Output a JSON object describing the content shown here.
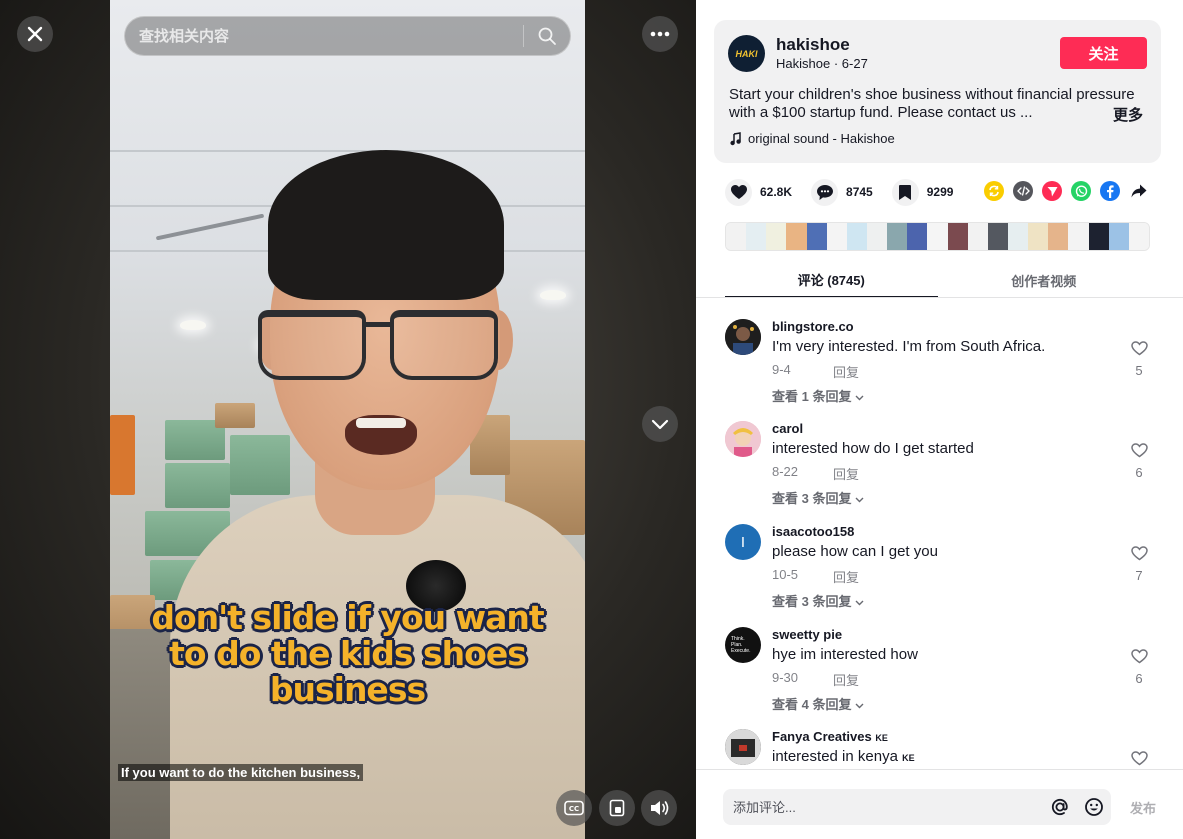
{
  "video": {
    "search_placeholder": "查找相关内容",
    "caption_lines": [
      "don't slide if you want",
      "to do the kids shoes",
      "business"
    ],
    "subtitle": "If you want to do the kitchen business,",
    "icons": {
      "close": "close-icon",
      "search": "search-icon",
      "more": "more-dots-icon",
      "next": "chevron-down-icon",
      "captions": "closed-caption-icon",
      "float": "floating-player-icon",
      "volume": "volume-icon"
    }
  },
  "author": {
    "logo_text": "HAKI",
    "username": "hakishoe",
    "nickname": "Hakishoe",
    "date": "6-27",
    "follow_label": "关注",
    "description": "Start your children's shoe business without financial pressure with a $100 startup fund. Please contact us ...",
    "more_label": "更多",
    "music": "original sound - Hakishoe"
  },
  "stats": {
    "likes": "62.8K",
    "comments": "8745",
    "saves": "9299"
  },
  "share": [
    {
      "name": "repost-icon",
      "color": "#facd00"
    },
    {
      "name": "embed-icon",
      "color": "#55565c"
    },
    {
      "name": "send-to-friends-icon",
      "color": "#fe2c55"
    },
    {
      "name": "whatsapp-icon",
      "color": "#25d366"
    },
    {
      "name": "facebook-icon",
      "color": "#1877f2"
    },
    {
      "name": "share-arrow-icon",
      "color": "#161823"
    }
  ],
  "tabs": [
    {
      "label": "评论 (8745)",
      "active": true
    },
    {
      "label": "创作者视频",
      "active": false
    }
  ],
  "comments": [
    {
      "user": "blingstore.co",
      "text": "I'm very interested. I'm from South Africa.",
      "date": "9-4",
      "reply": "回复",
      "view_replies": "查看 1 条回复",
      "likes": "5",
      "avatar_color": "#2b2b2b",
      "avatar_letter": ""
    },
    {
      "user": "carol",
      "text": "interested how do I get started",
      "date": "8-22",
      "reply": "回复",
      "view_replies": "查看 3 条回复",
      "likes": "6",
      "avatar_color": "#e8a7b8",
      "avatar_letter": ""
    },
    {
      "user": "isaacotoo158",
      "text": "please how can I get you",
      "date": "10-5",
      "reply": "回复",
      "view_replies": "查看 3 条回复",
      "likes": "7",
      "avatar_color": "#1f6eb5",
      "avatar_letter": "I"
    },
    {
      "user": "sweetty pie",
      "text": "hye im interested how",
      "date": "9-30",
      "reply": "回复",
      "view_replies": "查看 4 条回复",
      "likes": "6",
      "avatar_color": "#111111",
      "avatar_letter": "Think. Plan. Execute."
    },
    {
      "user": "Fanya Creatives",
      "user_badge": "KE",
      "text": "interested in kenya",
      "text_badge": "KE",
      "avatar_color": "#3a3a3a",
      "avatar_letter": ""
    }
  ],
  "comment_input": {
    "placeholder": "添加评论...",
    "post_label": "发布"
  },
  "colors": {
    "accent": "#fe2c55",
    "caption_yellow": "#f4b22a"
  }
}
